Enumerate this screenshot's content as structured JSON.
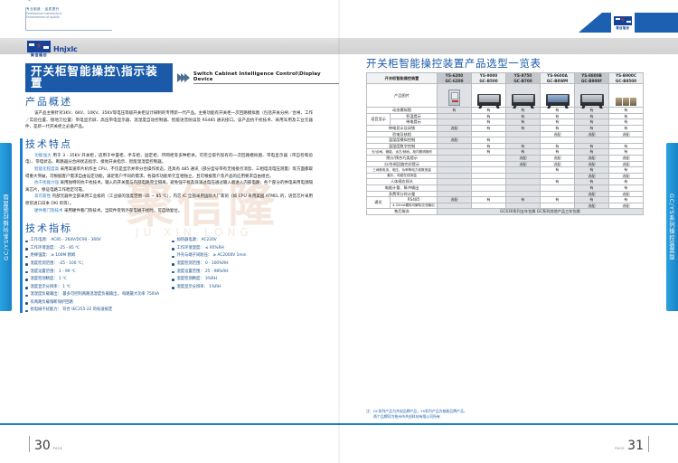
{
  "header": {
    "slogan_cn": "专业制造 · 品质提升",
    "slogan_en_l1": "Professional manufacture",
    "slogan_en_l2": "Enhancement of quality",
    "logo_cn": "聚信隆创",
    "logo_en": "Hnjxlc",
    "logo_bolt": "⚡"
  },
  "left_page": {
    "banner": {
      "title_cn": "开关柜智能操控\\指示装置",
      "title_en": "Switch Cabinet Intelligence Control\\Display Device",
      "chevron_icon": "chevrons-right-icon"
    },
    "overview": {
      "heading": "产品概述",
      "paragraph": "该产品主要针对3KV、6KV、10KV、35KV等电压等级开关柜设计研制的专用新一代产品。主要功能有开关柜一次回路模拟图（包括开关分闸／合闸、工作／实验位置、接地刀位置）带电显示屏、高压带电显示器、温湿度自动控制器、智能语音防误及 RS485 通讯接口。该产品抗干扰技术、采用军用及工业元器件，是新一代开关柜之必备产品。"
    },
    "features": {
      "heading": "技术特点",
      "items": [
        {
          "kw": "功能强大",
          "text": "用于 3 - 35KV 开关柜，适用于中置柜、手车柜、固定柜、环网柜等多种柜体。可完全取代现有的一次回路模拟图、带电显示器（带自检和验电）、带电状态、断路器分合闸状态指示、接地开关指示、智能温湿度控制器。"
        },
        {
          "kw": "智能化程度高",
          "text": "采用高速单片机作主 CPU，不仅是显示并单分合操作状态，还具有 485 通讯（部分型号带有无线接点消息、三相电流电压测量）等方面都取得重大突破，可根据客户需求自由设定功能，满足客户不同的需求。各操作功能单元互相独立，且可根据客户及产品的应用要求自由组合。"
        },
        {
          "kw": "抗干扰能力强",
          "text": "采用独特的抗干扰技术。输入的开关量与内部电路完全隔离，避免强干扰及浪涌过电压通过输入端进入内部电路；各个部分的供电采用电源隔离芯片，保证电路工作稳定可靠。"
        },
        {
          "kw": "高可靠性",
          "text": "内部元器件全部采用工业级的（工业级的温度范围 -35 ~ 85 ℃），内芯 IC 全部采用国际大厂家的（如 CPU 采用美国 ATMEL 的，语音芯片采用原装进口日本 OKI 的等）。"
        },
        {
          "kw": "硬件看门狗技术",
          "text": "采用硬件看门狗技术。当软件受到外部电磁干扰时，可自动复位。"
        }
      ]
    },
    "specs": {
      "heading": "技术指标",
      "left_items": [
        "工作电源： AC85 - 264V/DC90 - 360V",
        "工作环境温度： -25 - 85 ℃",
        "绝缘强度： ≥ 100M 欧姆",
        "温度检测范围： -25 - 100 ℃；",
        "温度设置范围： 1 - 99 ℃",
        "温度检测精度： 1 ℃",
        "温度显示分辨率： 1 ℃"
      ],
      "right_items": [
        "加热器电源： AC220V",
        "工作环境湿度： ≤ 95%RH",
        "外壳与端子间耐压： ≥ AC2000V 1min",
        "湿度检测范围： 0 - 100%RH",
        "湿度设置范围： 25 - 98%RH",
        "湿度检测精度： 3%RH",
        "湿度显示分辨率： 1%RH"
      ],
      "wide_items": [
        "温湿度负载输出： 最多可控制两路温湿度负载输出， 每路最大功率 750VA",
        "有两路负载熔断保护回路",
        "抗电磁干扰能力： 符合 IEC255-22 的标准规定"
      ]
    }
  },
  "right_page": {
    "table_title": "开关柜智能操控装置产品选型一览表",
    "header_first": "开关柜智能操控装置",
    "models": [
      {
        "l1": "YS-6200",
        "l2": "GC-6200"
      },
      {
        "l1": "YS-9000",
        "l2": "GC-B500"
      },
      {
        "l1": "YS-9750",
        "l2": "GC-B700"
      },
      {
        "l1": "YS-9600A",
        "l2": "GC-B8WM"
      },
      {
        "l1": "YS-8800B",
        "l2": "GC-B900F"
      },
      {
        "l1": "YS-B900C",
        "l2": "GC-B8500"
      }
    ],
    "photo_row_label": "产品图片",
    "rows": [
      {
        "label": "动态模拟图",
        "group": null,
        "values": [
          "有",
          "有",
          "有",
          "有",
          "有",
          "有"
        ]
      },
      {
        "label": "积温提示",
        "group": "语音显示",
        "group_rows": 2,
        "values": [
          "",
          "有",
          "有",
          "有",
          "有",
          "有"
        ]
      },
      {
        "label": "带电提示",
        "group": null,
        "values": [
          "",
          "有",
          "有",
          "有",
          "有",
          "有"
        ]
      },
      {
        "label": "带电显示及闭锁",
        "group": null,
        "values": [
          "选配",
          "有",
          "有",
          "有",
          "有",
          "有"
        ]
      },
      {
        "label": "验电及核相",
        "group": null,
        "values": [
          "",
          "",
          "",
          "选配",
          "选配",
          "选配"
        ]
      },
      {
        "label": "温湿度模拟控制",
        "group": null,
        "values": [
          "选配",
          "有",
          "",
          "",
          "",
          ""
        ]
      },
      {
        "label": "温湿度数字控制",
        "group": null,
        "values": [
          "",
          "有",
          "有",
          "有",
          "有",
          "有"
        ]
      },
      {
        "label": "分/合闸、储能、远方/就地、柜内照明操作",
        "group": null,
        "values": [
          "",
          "有",
          "有",
          "有",
          "有",
          "有"
        ]
      },
      {
        "label": "预分/预合巧类提示",
        "group": null,
        "values": [
          "",
          "",
          "选配",
          "选配",
          "选配",
          "选配"
        ]
      },
      {
        "label": "分/合闸回路完好提示",
        "group": null,
        "values": [
          "",
          "",
          "选配",
          "选配",
          "选配",
          "选配"
        ]
      },
      {
        "label": "三间断电流、电压、功率等电力参数测量",
        "group": null,
        "values": [
          "",
          "",
          "",
          "有",
          "有",
          "有"
        ]
      },
      {
        "label": "触头、电缆在线测温",
        "group": null,
        "values": [
          "",
          "",
          "",
          "",
          "选配",
          "选配"
        ]
      },
      {
        "label": "人体感应探头",
        "group": null,
        "values": [
          "",
          "",
          "",
          "有",
          "有",
          "有"
        ]
      },
      {
        "label": "电能计量、脉冲输出",
        "group": null,
        "values": [
          "",
          "",
          "",
          "",
          "有",
          "有"
        ]
      },
      {
        "label": "多费率分时计量",
        "group": null,
        "values": [
          "",
          "",
          "",
          "",
          "选配",
          "选配"
        ]
      },
      {
        "label": "RS485",
        "group": "通讯",
        "group_rows": 2,
        "values": [
          "选配",
          "有",
          "有",
          "有",
          "有",
          "有"
        ]
      },
      {
        "label": "4-20mA模拟可解除交流输出",
        "group": null,
        "values": [
          "",
          "",
          "",
          "",
          "选配",
          "选配"
        ]
      },
      {
        "label": "售后服务",
        "group": null,
        "merged": "GC630系列五年包换 GC系列其他产品三年包换"
      }
    ],
    "note_l1": "注：GC系列产品为共创品牌产品，YS系列产品为柏能品牌产品，",
    "note_l2": "两个品牌同为柏州市共创科技有限公司所有"
  },
  "side_tab_text": "GC/YS系列操控装置型",
  "footer": {
    "page_left": "30",
    "page_right": "31",
    "page_label": "PAGE"
  },
  "watermark": {
    "line1": "聚信隆",
    "line2": "JU XIN LONG"
  },
  "colors": {
    "brand_blue": "#1b5aa8",
    "accent_cyan": "#1a82c8",
    "red": "#e8382c",
    "table_shade": "#dfe1e4"
  }
}
